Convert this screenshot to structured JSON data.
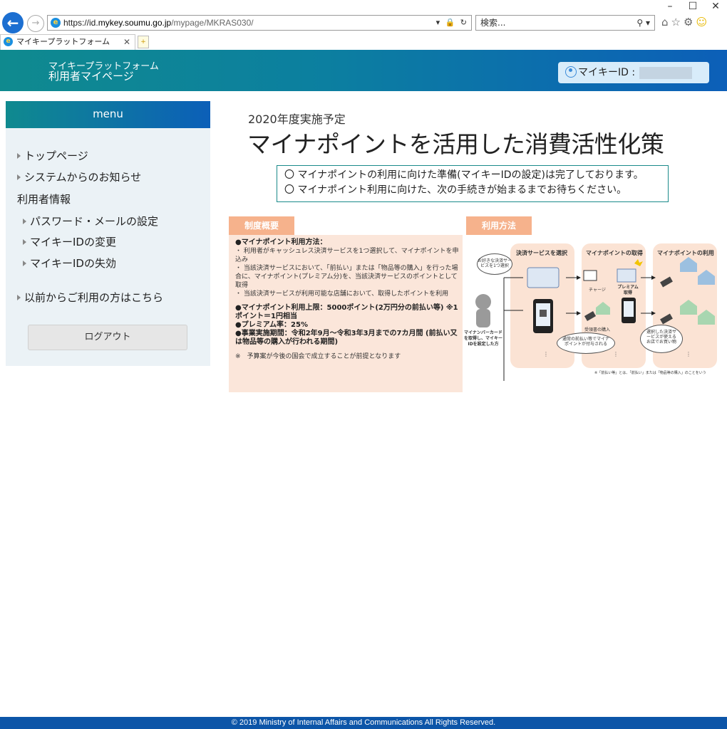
{
  "browser": {
    "url_prefix": "https://id.",
    "url_domain": "mykey.soumu.go.jp",
    "url_path": "/mypage/MKRAS030/",
    "search_placeholder": "検索...",
    "tab_title": "マイキープラットフォーム",
    "window_controls": [
      "–",
      "☐",
      "✕"
    ]
  },
  "header": {
    "brand_line1": "マイキープラットフォーム",
    "brand_line2": "利用者マイページ",
    "mykey_label": "マイキーID :"
  },
  "sidebar": {
    "menu_title": "menu",
    "items": [
      {
        "label": "トップページ"
      },
      {
        "label": "システムからのお知らせ"
      },
      {
        "label": "利用者情報"
      },
      {
        "label": "パスワード・メールの設定"
      },
      {
        "label": "マイキーIDの変更"
      },
      {
        "label": "マイキーIDの失効"
      },
      {
        "label": "以前からご利用の方はこちら"
      }
    ],
    "logout_label": "ログアウト"
  },
  "main": {
    "subtitle": "2020年度実施予定",
    "title": "マイナポイントを活用した消費活性化策",
    "notice": [
      "〇 マイナポイントの利用に向けた準備(マイキーIDの設定)は完了しております。",
      "〇 マイナポイント利用に向けた、次の手続きが始まるまでお待ちください。"
    ]
  },
  "infographic": {
    "overview_tag": "制度概要",
    "usage_tag": "利用方法",
    "how_heading": "●マイナポイント利用方法：",
    "how_items": [
      "・ 利用者がキャッシュレス決済サービスを1つ選択して、マイナポイントを申込み",
      "・ 当該決済サービスにおいて、「前払い」または「物品等の購入」を行った場合に、マイナポイント(プレミアム分)を、当該決済サービスのポイントとして取得",
      "・ 当該決済サービスが利用可能な店舗において、取得したポイントを利用"
    ],
    "limit": "●マイナポイント利用上限：5000ポイント(2万円分の前払い等) ※1ポイント＝1円相当",
    "premium": "●プレミアム率：25%",
    "period": "●事業実施期間：令和2年9月～令和3年3月までの7カ月間 (前払い又は物品等の購入が行われる期間)",
    "budget_note": "※　予算案が今後の国会で成立することが前提となります",
    "col1": "決済サービスを選択",
    "col2": "マイナポイントの取得",
    "col3": "マイナポイントの利用",
    "bubble1": "お好きな決済サービスを1つ選択",
    "user_caption": "マイナンバーカードを取得し、マイキーIDを設定した方",
    "charge": "チャージ",
    "premium_get": "プレミアム取得",
    "purchase": "受領書の購入",
    "bubble2": "通常の前払い等でマイナポイントが付与される",
    "bubble3": "選択した決済サービスが使えるお店でお買い物",
    "diagram_note": "※「前払い等」とは、「前払い」または「物品等の購入」のことをいう"
  },
  "footer": {
    "copyright": "© 2019 Ministry of Internal Affairs and Communications All Rights Reserved."
  }
}
